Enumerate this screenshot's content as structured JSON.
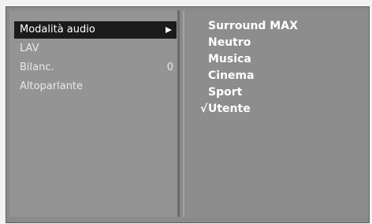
{
  "left_menu": {
    "items": [
      {
        "label": "Modalità audio",
        "selected": true,
        "has_submenu": true
      },
      {
        "label": "LAV"
      },
      {
        "label": "Bilanc.",
        "value": "0"
      },
      {
        "label": "Altoparlante"
      }
    ],
    "arrow_icon": "arrow-right-icon"
  },
  "submenu": {
    "options": [
      {
        "label": "Surround MAX"
      },
      {
        "label": "Neutro"
      },
      {
        "label": "Musica"
      },
      {
        "label": "Cinema"
      },
      {
        "label": "Sport"
      },
      {
        "label": "Utente",
        "checked": true
      }
    ],
    "check_mark": "√"
  },
  "colors": {
    "panel": "#949494",
    "selected_bg": "#1b1b1b",
    "text": "#ffffff"
  }
}
